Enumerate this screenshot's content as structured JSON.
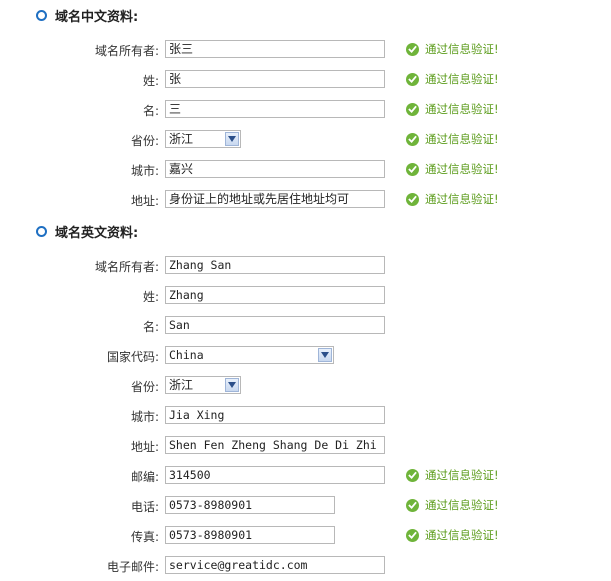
{
  "colors": {
    "bullet": "#1e6fc2",
    "verify_text": "#5c9c1c",
    "verify_icon": "#6fb43a"
  },
  "chinese": {
    "title": "域名中文资料:",
    "rows": [
      {
        "label": "域名所有者:",
        "value": "张三",
        "verify": "通过信息验证!"
      },
      {
        "label": "姓:",
        "value": "张",
        "verify": "通过信息验证!"
      },
      {
        "label": "名:",
        "value": "三",
        "verify": "通过信息验证!"
      },
      {
        "label": "省份:",
        "value": "浙江",
        "verify": "通过信息验证!"
      },
      {
        "label": "城市:",
        "value": "嘉兴",
        "verify": "通过信息验证!"
      },
      {
        "label": "地址:",
        "value": "身份证上的地址或先居住地址均可",
        "verify": "通过信息验证!"
      }
    ]
  },
  "english": {
    "title": "域名英文资料:",
    "rows": [
      {
        "label": "域名所有者:",
        "value": "Zhang San"
      },
      {
        "label": "姓:",
        "value": "Zhang"
      },
      {
        "label": "名:",
        "value": "San"
      },
      {
        "label": "国家代码:",
        "value": "China"
      },
      {
        "label": "省份:",
        "value": "浙江"
      },
      {
        "label": "城市:",
        "value": "Jia Xing"
      },
      {
        "label": "地址:",
        "value": "Shen Fen Zheng Shang De Di Zhi"
      },
      {
        "label": "邮编:",
        "value": "314500",
        "verify": "通过信息验证!"
      },
      {
        "label": "电话:",
        "value": "0573-8980901",
        "verify": "通过信息验证!"
      },
      {
        "label": "传真:",
        "value": "0573-8980901",
        "verify": "通过信息验证!"
      },
      {
        "label": "电子邮件:",
        "value": "service@greatidc.com"
      }
    ]
  }
}
